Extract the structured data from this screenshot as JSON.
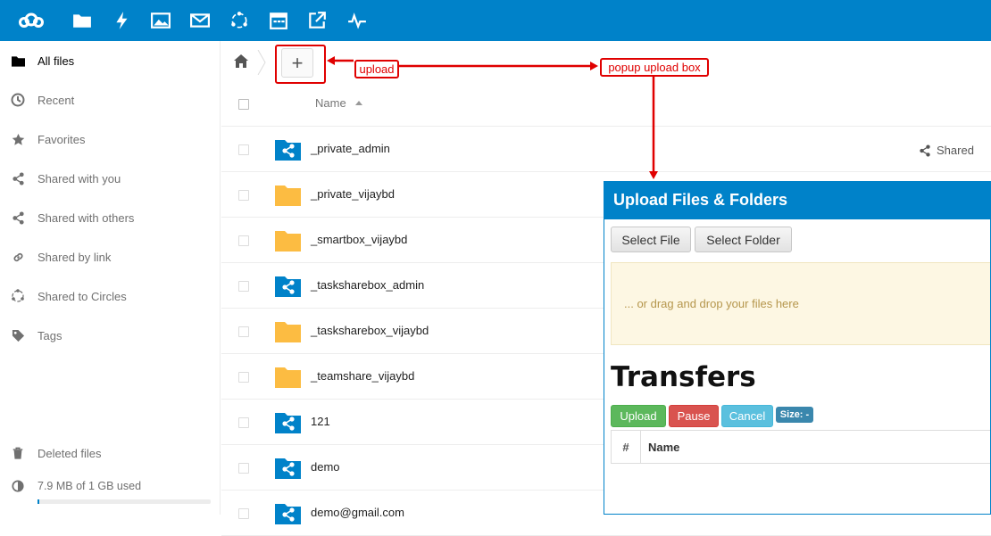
{
  "topbar": {
    "color": "#0082c9",
    "icons": [
      "nextcloud-logo-icon",
      "files-icon",
      "activity-icon",
      "gallery-icon",
      "mail-icon",
      "circles-icon",
      "calendar-icon",
      "external-link-icon",
      "monitoring-icon"
    ]
  },
  "sidebar": {
    "items": [
      {
        "label": "All files",
        "icon": "folder-icon"
      },
      {
        "label": "Recent",
        "icon": "clock-icon"
      },
      {
        "label": "Favorites",
        "icon": "star-icon"
      },
      {
        "label": "Shared with you",
        "icon": "share-icon"
      },
      {
        "label": "Shared with others",
        "icon": "share-icon"
      },
      {
        "label": "Shared by link",
        "icon": "link-icon"
      },
      {
        "label": "Shared to Circles",
        "icon": "circles-icon"
      },
      {
        "label": "Tags",
        "icon": "tag-icon"
      }
    ],
    "deleted_files": "Deleted files",
    "quota": "7.9 MB of 1 GB used",
    "quota_fraction": 0.0079
  },
  "files": {
    "column_name": "Name",
    "shared_label": "Shared",
    "rows": [
      {
        "name": "_private_admin",
        "type": "shared-folder"
      },
      {
        "name": "_private_vijaybd",
        "type": "folder"
      },
      {
        "name": "_smartbox_vijaybd",
        "type": "folder"
      },
      {
        "name": "_tasksharebox_admin",
        "type": "shared-folder"
      },
      {
        "name": "_tasksharebox_vijaybd",
        "type": "folder"
      },
      {
        "name": "_teamshare_vijaybd",
        "type": "folder"
      },
      {
        "name": "121",
        "type": "shared-folder"
      },
      {
        "name": "demo",
        "type": "shared-folder"
      },
      {
        "name": "demo@gmail.com",
        "type": "shared-folder"
      }
    ]
  },
  "popup": {
    "title": "Upload Files & Folders",
    "select_file": "Select File",
    "select_folder": "Select Folder",
    "dropzone": "... or drag and drop your files here",
    "transfers_title": "Transfers",
    "upload": "Upload",
    "pause": "Pause",
    "cancel": "Cancel",
    "size": "Size: -",
    "col_hash": "#",
    "col_name": "Name"
  },
  "annotations": {
    "upload": "upload",
    "popup": "popup upload box",
    "color": "#e00000"
  },
  "add_button": "+"
}
